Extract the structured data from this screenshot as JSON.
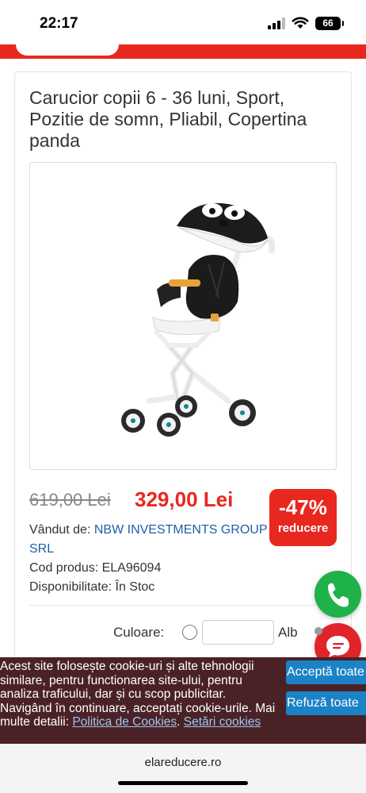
{
  "status_bar": {
    "time": "22:17",
    "battery": "66"
  },
  "product": {
    "title": "Carucior copii 6 - 36 luni, Sport, Pozitie de somn, Pliabil, Copertina panda",
    "image_alt": "carucior panda",
    "old_price": "619,00 Lei",
    "new_price": "329,00 Lei",
    "discount_percent": "-47%",
    "discount_label": "reducere",
    "seller_label": "Vândut de: ",
    "seller_name_line1": "NBW INVESTMENTS GROUP",
    "seller_name_line2": "SRL",
    "code_line": "Cod produs: ELA96094",
    "availability_line": "Disponibilitate: În Stoc",
    "color_label": "Culoare:",
    "color_value": "Alb"
  },
  "cookie_banner": {
    "text_part1": "Acest site folosește cookie-uri și alte tehnologii similare, pentru functionarea site-ului, pentru analiza traficului, dar și cu scop publicitar. Navigând în continuare, acceptați cookie-urile. Mai multe detalii: ",
    "policy_link": "Politica de Cookies",
    "separator": ". ",
    "settings_link": "Setări cookies",
    "accept_label": "Acceptă toate",
    "refuse_label": "Refuză toate"
  },
  "browser": {
    "url": "elareducere.ro"
  },
  "colors": {
    "brand_red": "#e8271f",
    "link_blue": "#1f5fa8",
    "whatsapp_green": "#1fb14a",
    "cookie_bg": "#4a2226",
    "button_blue": "#1b82c6"
  },
  "icons": {
    "signal": "signal-icon",
    "wifi": "wifi-icon",
    "battery": "battery-icon",
    "phone": "phone-icon",
    "chat": "chat-icon"
  }
}
